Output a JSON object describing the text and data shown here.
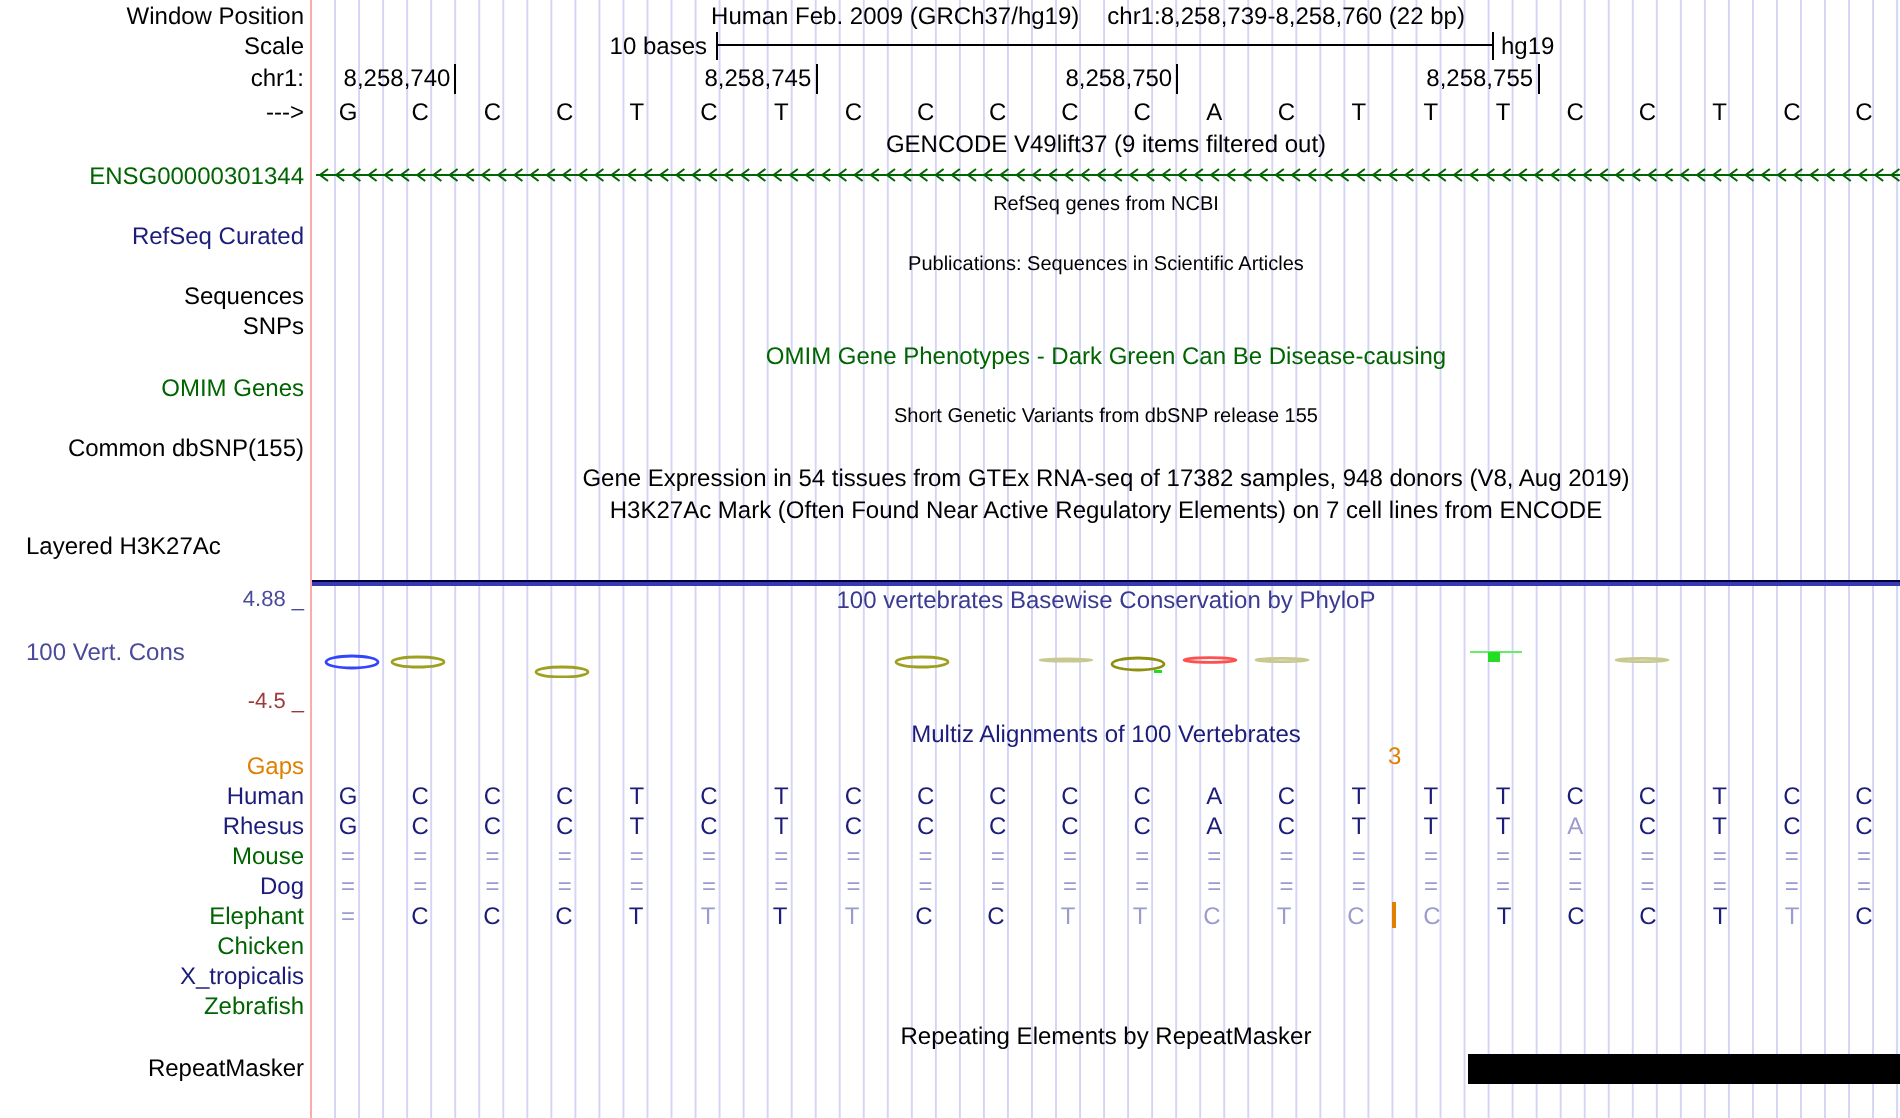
{
  "header": {
    "label": "Window Position",
    "assembly": "Human Feb. 2009 (GRCh37/hg19)",
    "position": "chr1:8,258,739-8,258,760 (22 bp)"
  },
  "scale": {
    "label": "Scale",
    "text": "10 bases",
    "assembly": "hg19"
  },
  "ruler": {
    "label": "chr1:",
    "positions": [
      "8,258,740",
      "8,258,745",
      "8,258,750",
      "8,258,755"
    ]
  },
  "sequence": {
    "label": "--->",
    "bases": [
      "G",
      "C",
      "C",
      "C",
      "T",
      "C",
      "T",
      "C",
      "C",
      "C",
      "C",
      "C",
      "A",
      "C",
      "T",
      "T",
      "T",
      "C",
      "C",
      "T",
      "C",
      "C"
    ]
  },
  "tracks": [
    {
      "kind": "title",
      "text": "GENCODE V49lift37 (9 items filtered out)",
      "color": "#000000"
    },
    {
      "kind": "gene",
      "label": "ENSG00000301344",
      "color": "#006400"
    },
    {
      "kind": "note",
      "text": "RefSeq genes from NCBI"
    },
    {
      "kind": "label",
      "label": "RefSeq Curated",
      "color": "#1c1c7a"
    },
    {
      "kind": "note",
      "text": "Publications: Sequences in Scientific Articles"
    },
    {
      "kind": "label",
      "label": "Sequences",
      "color": "#000000"
    },
    {
      "kind": "label",
      "label": "SNPs",
      "color": "#000000"
    },
    {
      "kind": "title",
      "text": "OMIM Gene Phenotypes - Dark Green Can Be Disease-causing",
      "color": "#006400"
    },
    {
      "kind": "label",
      "label": "OMIM Genes",
      "color": "#006400"
    },
    {
      "kind": "note",
      "text": "Short Genetic Variants from dbSNP release 155"
    },
    {
      "kind": "label",
      "label": "Common dbSNP(155)",
      "color": "#000000"
    },
    {
      "kind": "title",
      "text": "Gene Expression in 54 tissues from GTEx RNA-seq of 17382 samples, 948 donors (V8, Aug 2019)",
      "color": "#000000"
    },
    {
      "kind": "title",
      "text": "H3K27Ac Mark (Often Found Near Active Regulatory Elements) on 7 cell lines from ENCODE",
      "color": "#000000"
    },
    {
      "kind": "label_left",
      "label": "Layered H3K27Ac",
      "color": "#000000"
    },
    {
      "kind": "separator"
    },
    {
      "kind": "phylop",
      "title": "100 vertebrates Basewise Conservation by PhyloP",
      "label": "100 Vert. Cons",
      "max": "4.88 _",
      "min": "-4.5 _"
    },
    {
      "kind": "title",
      "text": "Multiz Alignments of 100 Vertebrates",
      "color": "#1c1c7a"
    },
    {
      "kind": "gaps",
      "label": "Gaps",
      "count": "3"
    },
    {
      "kind": "species",
      "label": "Human",
      "color": "#1c1c7a",
      "cells": [
        {
          "kind": "base",
          "base": "G",
          "faded": false
        },
        {
          "kind": "base",
          "base": "C",
          "faded": false
        },
        {
          "kind": "base",
          "base": "C",
          "faded": false
        },
        {
          "kind": "base",
          "base": "C",
          "faded": false
        },
        {
          "kind": "base",
          "base": "T",
          "faded": false
        },
        {
          "kind": "base",
          "base": "C",
          "faded": false
        },
        {
          "kind": "base",
          "base": "T",
          "faded": false
        },
        {
          "kind": "base",
          "base": "C",
          "faded": false
        },
        {
          "kind": "base",
          "base": "C",
          "faded": false
        },
        {
          "kind": "base",
          "base": "C",
          "faded": false
        },
        {
          "kind": "base",
          "base": "C",
          "faded": false
        },
        {
          "kind": "base",
          "base": "C",
          "faded": false
        },
        {
          "kind": "base",
          "base": "A",
          "faded": false
        },
        {
          "kind": "base",
          "base": "C",
          "faded": false
        },
        {
          "kind": "base",
          "base": "T",
          "faded": false
        },
        {
          "kind": "base",
          "base": "T",
          "faded": false
        },
        {
          "kind": "base",
          "base": "T",
          "faded": false
        },
        {
          "kind": "base",
          "base": "C",
          "faded": false
        },
        {
          "kind": "base",
          "base": "C",
          "faded": false
        },
        {
          "kind": "base",
          "base": "T",
          "faded": false
        },
        {
          "kind": "base",
          "base": "C",
          "faded": false
        },
        {
          "kind": "base",
          "base": "C",
          "faded": false
        }
      ]
    },
    {
      "kind": "species",
      "label": "Rhesus",
      "color": "#1c1c7a",
      "cells": [
        {
          "kind": "base",
          "base": "G",
          "faded": false
        },
        {
          "kind": "base",
          "base": "C",
          "faded": false
        },
        {
          "kind": "base",
          "base": "C",
          "faded": false
        },
        {
          "kind": "base",
          "base": "C",
          "faded": false
        },
        {
          "kind": "base",
          "base": "T",
          "faded": false
        },
        {
          "kind": "base",
          "base": "C",
          "faded": false
        },
        {
          "kind": "base",
          "base": "T",
          "faded": false
        },
        {
          "kind": "base",
          "base": "C",
          "faded": false
        },
        {
          "kind": "base",
          "base": "C",
          "faded": false
        },
        {
          "kind": "base",
          "base": "C",
          "faded": false
        },
        {
          "kind": "base",
          "base": "C",
          "faded": false
        },
        {
          "kind": "base",
          "base": "C",
          "faded": false
        },
        {
          "kind": "base",
          "base": "A",
          "faded": false
        },
        {
          "kind": "base",
          "base": "C",
          "faded": false
        },
        {
          "kind": "base",
          "base": "T",
          "faded": false
        },
        {
          "kind": "base",
          "base": "T",
          "faded": false
        },
        {
          "kind": "base",
          "base": "T",
          "faded": false
        },
        {
          "kind": "base",
          "base": "A",
          "faded": true
        },
        {
          "kind": "base",
          "base": "C",
          "faded": false
        },
        {
          "kind": "base",
          "base": "T",
          "faded": false
        },
        {
          "kind": "base",
          "base": "C",
          "faded": false
        },
        {
          "kind": "base",
          "base": "C",
          "faded": false
        }
      ]
    },
    {
      "kind": "species",
      "label": "Mouse",
      "color": "#006400",
      "cells": [
        {
          "kind": "base",
          "base": "=",
          "faded": true
        },
        {
          "kind": "base",
          "base": "=",
          "faded": true
        },
        {
          "kind": "base",
          "base": "=",
          "faded": true
        },
        {
          "kind": "base",
          "base": "=",
          "faded": true
        },
        {
          "kind": "base",
          "base": "=",
          "faded": true
        },
        {
          "kind": "base",
          "base": "=",
          "faded": true
        },
        {
          "kind": "base",
          "base": "=",
          "faded": true
        },
        {
          "kind": "base",
          "base": "=",
          "faded": true
        },
        {
          "kind": "base",
          "base": "=",
          "faded": true
        },
        {
          "kind": "base",
          "base": "=",
          "faded": true
        },
        {
          "kind": "base",
          "base": "=",
          "faded": true
        },
        {
          "kind": "base",
          "base": "=",
          "faded": true
        },
        {
          "kind": "base",
          "base": "=",
          "faded": true
        },
        {
          "kind": "base",
          "base": "=",
          "faded": true
        },
        {
          "kind": "base",
          "base": "=",
          "faded": true
        },
        {
          "kind": "base",
          "base": "=",
          "faded": true
        },
        {
          "kind": "base",
          "base": "=",
          "faded": true
        },
        {
          "kind": "base",
          "base": "=",
          "faded": true
        },
        {
          "kind": "base",
          "base": "=",
          "faded": true
        },
        {
          "kind": "base",
          "base": "=",
          "faded": true
        },
        {
          "kind": "base",
          "base": "=",
          "faded": true
        },
        {
          "kind": "base",
          "base": "=",
          "faded": true
        }
      ]
    },
    {
      "kind": "species",
      "label": "Dog",
      "color": "#1c1c7a",
      "cells": [
        {
          "kind": "base",
          "base": "=",
          "faded": true
        },
        {
          "kind": "base",
          "base": "=",
          "faded": true
        },
        {
          "kind": "base",
          "base": "=",
          "faded": true
        },
        {
          "kind": "base",
          "base": "=",
          "faded": true
        },
        {
          "kind": "base",
          "base": "=",
          "faded": true
        },
        {
          "kind": "base",
          "base": "=",
          "faded": true
        },
        {
          "kind": "base",
          "base": "=",
          "faded": true
        },
        {
          "kind": "base",
          "base": "=",
          "faded": true
        },
        {
          "kind": "base",
          "base": "=",
          "faded": true
        },
        {
          "kind": "base",
          "base": "=",
          "faded": true
        },
        {
          "kind": "base",
          "base": "=",
          "faded": true
        },
        {
          "kind": "base",
          "base": "=",
          "faded": true
        },
        {
          "kind": "base",
          "base": "=",
          "faded": true
        },
        {
          "kind": "base",
          "base": "=",
          "faded": true
        },
        {
          "kind": "base",
          "base": "=",
          "faded": true
        },
        {
          "kind": "base",
          "base": "=",
          "faded": true
        },
        {
          "kind": "base",
          "base": "=",
          "faded": true
        },
        {
          "kind": "base",
          "base": "=",
          "faded": true
        },
        {
          "kind": "base",
          "base": "=",
          "faded": true
        },
        {
          "kind": "base",
          "base": "=",
          "faded": true
        },
        {
          "kind": "base",
          "base": "=",
          "faded": true
        },
        {
          "kind": "base",
          "base": "=",
          "faded": true
        }
      ]
    },
    {
      "kind": "species",
      "label": "Elephant",
      "color": "#006400",
      "cells": [
        {
          "kind": "base",
          "base": "=",
          "faded": true
        },
        {
          "kind": "base",
          "base": "C",
          "faded": false
        },
        {
          "kind": "base",
          "base": "C",
          "faded": false
        },
        {
          "kind": "base",
          "base": "C",
          "faded": false
        },
        {
          "kind": "base",
          "base": "T",
          "faded": false
        },
        {
          "kind": "base",
          "base": "T",
          "faded": true
        },
        {
          "kind": "base",
          "base": "T",
          "faded": false
        },
        {
          "kind": "base",
          "base": "T",
          "faded": true
        },
        {
          "kind": "base",
          "base": "C",
          "faded": false
        },
        {
          "kind": "base",
          "base": "C",
          "faded": false
        },
        {
          "kind": "base",
          "base": "T",
          "faded": true
        },
        {
          "kind": "base",
          "base": "T",
          "faded": true
        },
        {
          "kind": "base",
          "base": "C",
          "faded": true
        },
        {
          "kind": "base",
          "base": "T",
          "faded": true
        },
        {
          "kind": "base",
          "base": "C",
          "faded": true
        },
        {
          "kind": "insertion"
        },
        {
          "kind": "base",
          "base": "C",
          "faded": true
        },
        {
          "kind": "base",
          "base": "T",
          "faded": false
        },
        {
          "kind": "base",
          "base": "C",
          "faded": false
        },
        {
          "kind": "base",
          "base": "C",
          "faded": false
        },
        {
          "kind": "base",
          "base": "T",
          "faded": false
        },
        {
          "kind": "base",
          "base": "T",
          "faded": true
        },
        {
          "kind": "base",
          "base": "C",
          "faded": false
        }
      ]
    },
    {
      "kind": "species",
      "label": "Chicken",
      "color": "#006400"
    },
    {
      "kind": "species",
      "label": "X_tropicalis",
      "color": "#1c1c7a"
    },
    {
      "kind": "species",
      "label": "Zebrafish",
      "color": "#006400"
    },
    {
      "kind": "title",
      "text": "Repeating Elements by RepeatMasker",
      "color": "#000000"
    },
    {
      "kind": "repeats",
      "label": "RepeatMasker",
      "masked": [
        false,
        false,
        false,
        false,
        false,
        false,
        false,
        false,
        false,
        false,
        false,
        false,
        false,
        false,
        false,
        false,
        true,
        true,
        true,
        true,
        true,
        true
      ]
    }
  ]
}
